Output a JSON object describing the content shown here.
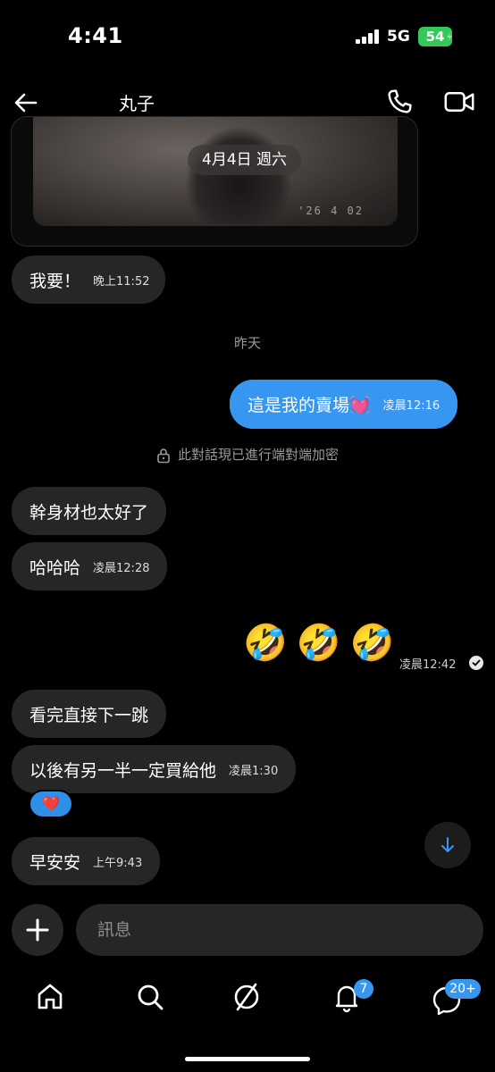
{
  "status_bar": {
    "time": "4:41",
    "network": "5G",
    "battery": "54"
  },
  "header": {
    "contact_name": "丸子",
    "back_icon": "arrow-left-icon",
    "call_icon": "phone-icon",
    "video_icon": "video-camera-icon"
  },
  "shared_image": {
    "date_label": "4月4日 週六",
    "camera_stamp": "'26 4 02"
  },
  "messages": {
    "m1": {
      "text": "我要！",
      "time": "晚上11:52"
    },
    "sep_yesterday": "昨天",
    "m2": {
      "text": "這是我的賣場💓",
      "time": "凌晨12:16"
    },
    "encryption_notice": "此對話現已進行端對端加密",
    "m3": {
      "text": "幹身材也太好了"
    },
    "m4": {
      "text": "哈哈哈",
      "time": "凌晨12:28"
    },
    "m5": {
      "emoji": "🤣",
      "time": "凌晨12:42"
    },
    "m6": {
      "text": "看完直接下一跳"
    },
    "m7": {
      "text": "以後有另一半一定買給他",
      "time": "凌晨1:30",
      "reaction": "❤️"
    },
    "m8": {
      "text": "早安安",
      "time": "上午9:43"
    }
  },
  "composer": {
    "placeholder": "訊息",
    "plus_icon": "plus-icon"
  },
  "bottom_nav": {
    "items": [
      {
        "name": "home",
        "icon": "home-icon"
      },
      {
        "name": "search",
        "icon": "search-icon"
      },
      {
        "name": "explore",
        "icon": "compass-icon"
      },
      {
        "name": "notifications",
        "icon": "bell-icon",
        "badge": "7"
      },
      {
        "name": "messages",
        "icon": "messenger-icon",
        "badge": "20+"
      }
    ]
  },
  "colors": {
    "accent": "#3797f0",
    "bubble_in": "#262626",
    "background": "#000000",
    "battery_green": "#34c759"
  }
}
